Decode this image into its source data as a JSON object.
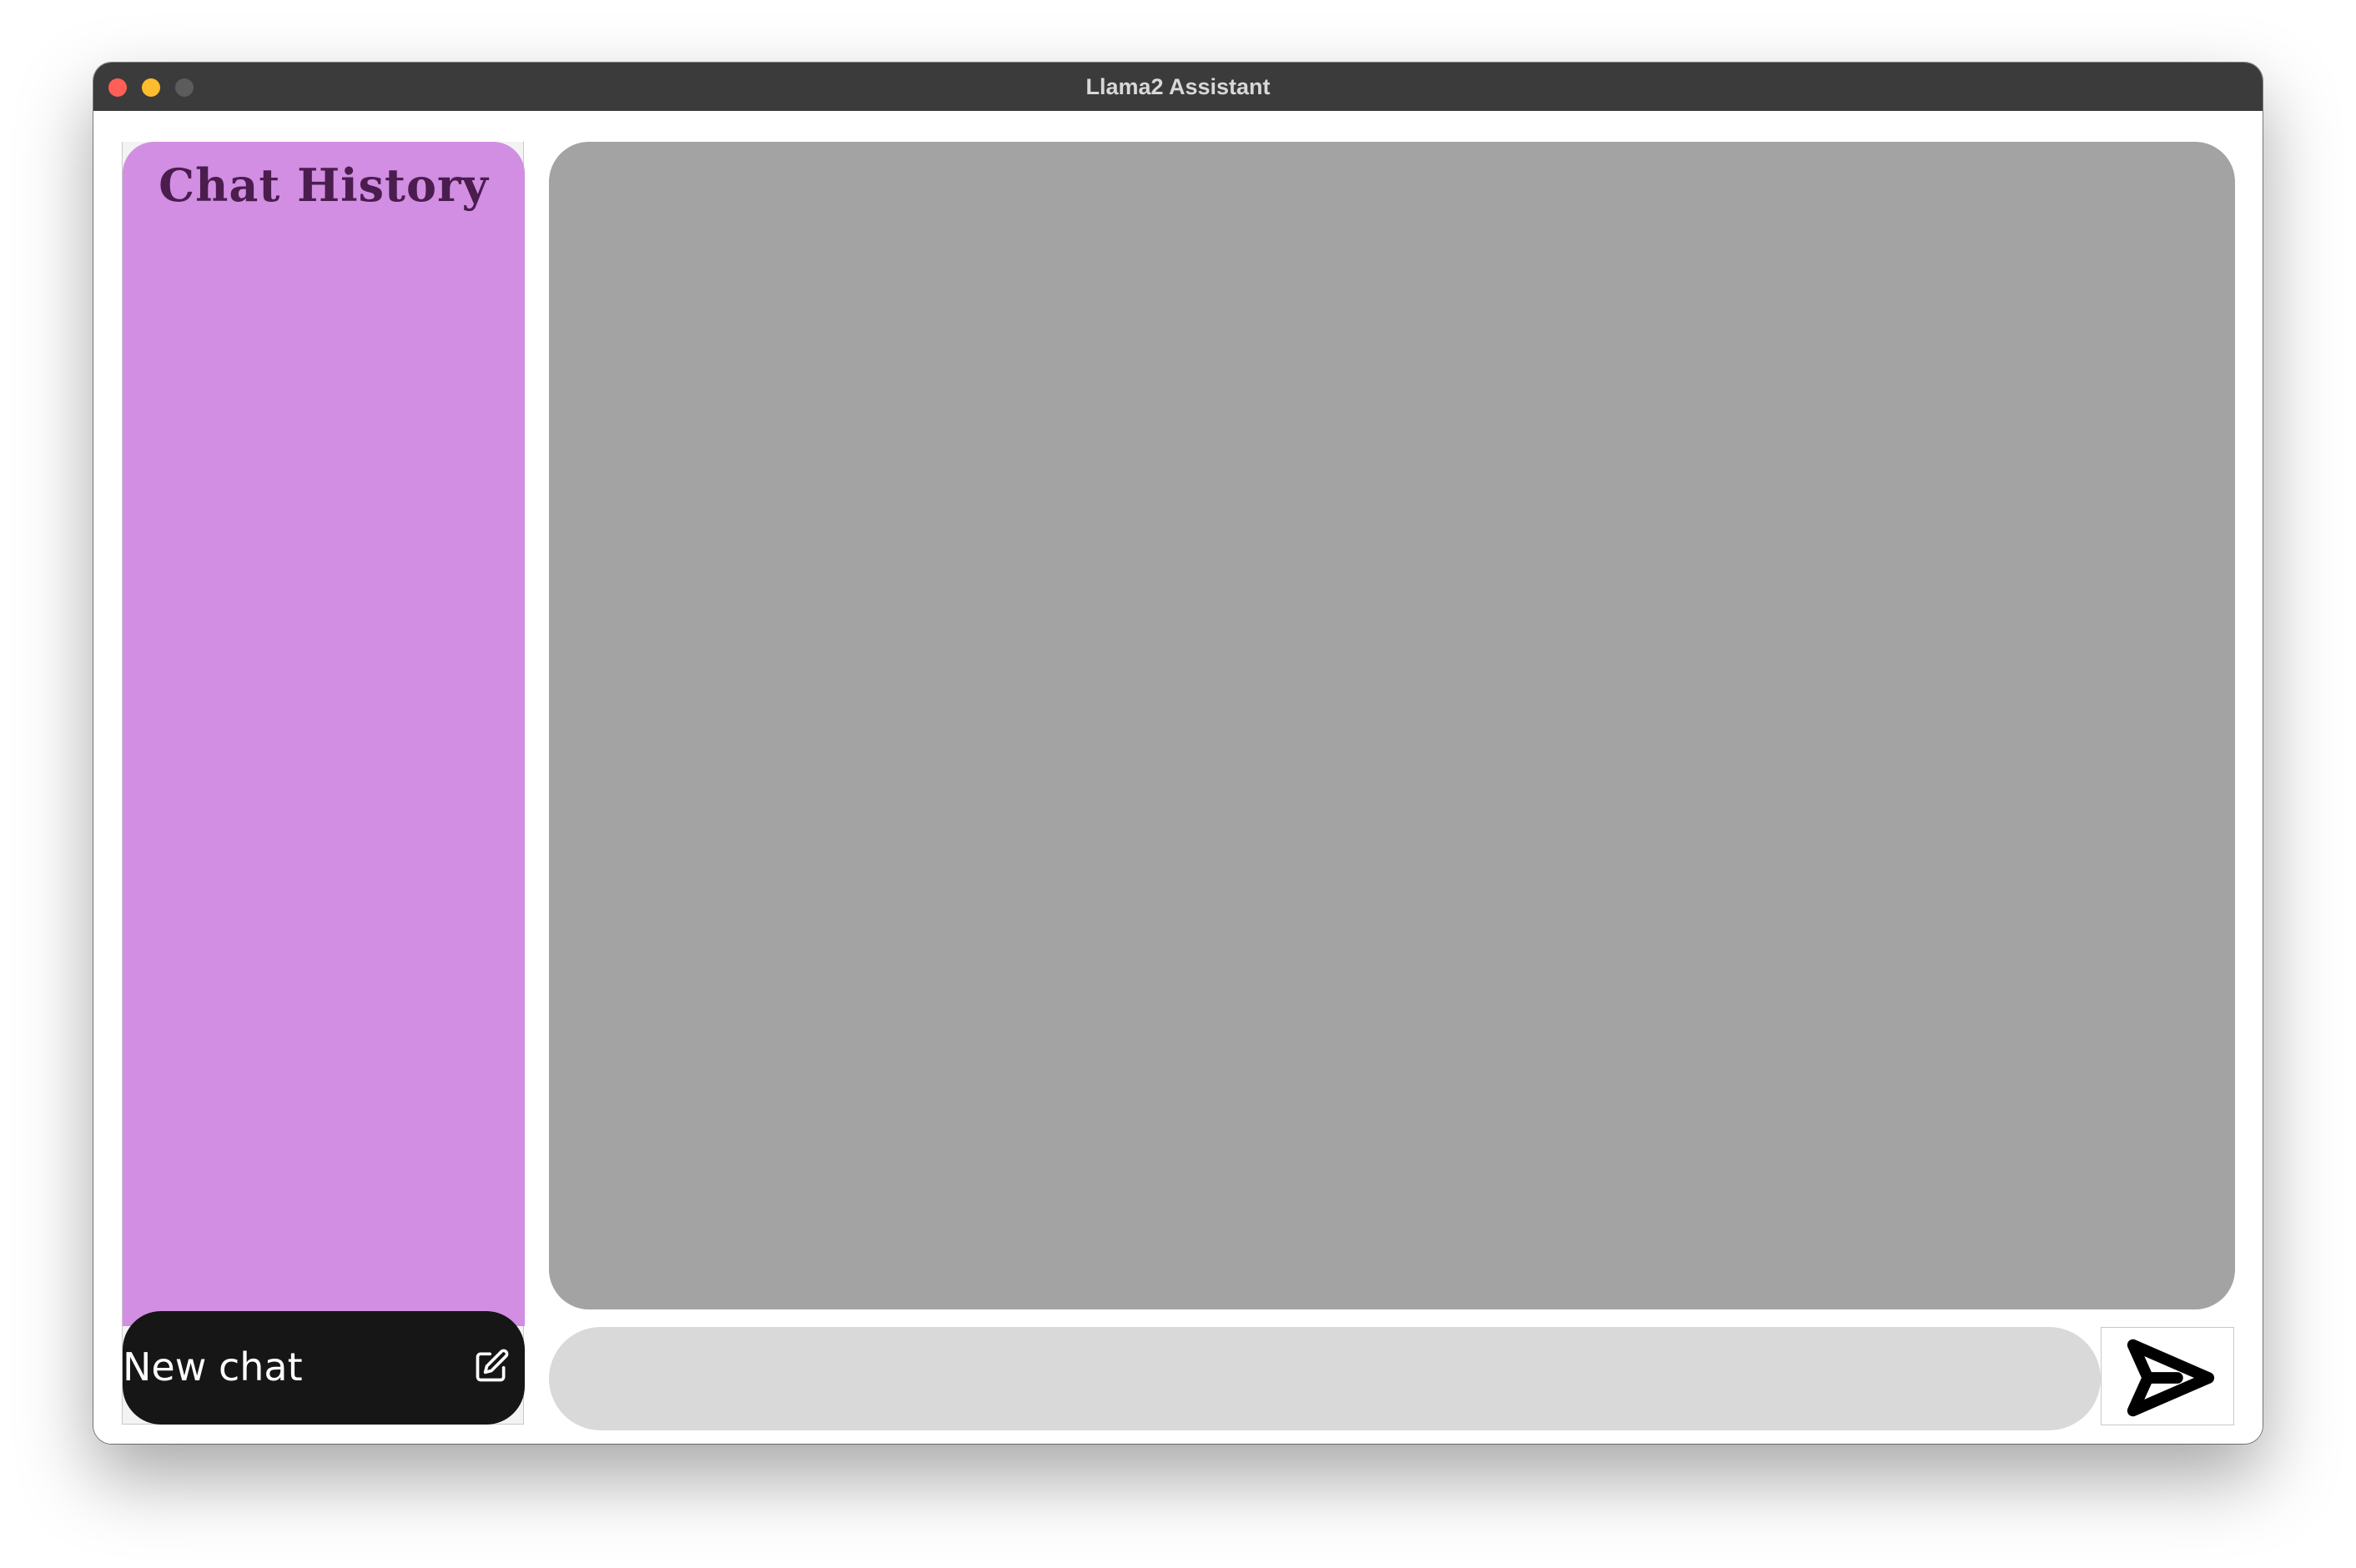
{
  "window": {
    "title": "Llama2 Assistant"
  },
  "sidebar": {
    "title": "Chat History",
    "panel_color": "#d28ee2",
    "new_chat_label": "New chat",
    "new_chat_icon": "edit-icon"
  },
  "chat": {
    "area_color": "#a3a3a3",
    "input_value": "",
    "input_placeholder": "",
    "send_icon": "send-icon"
  }
}
